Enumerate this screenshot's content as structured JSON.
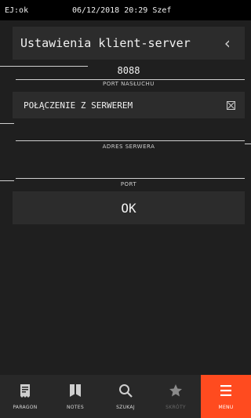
{
  "statusbar": {
    "left": "EJ:ok",
    "center": "06/12/2018 20:29 Szef"
  },
  "header": {
    "title": "Ustawienia klient-server",
    "back_icon": "chevron-left-icon"
  },
  "fields": {
    "port_nasluchu": {
      "value": "8088",
      "label": "PORT NASŁUCHU"
    },
    "polaczenie": {
      "label": "POŁĄCZENIE Z SERWEREM",
      "checked": true
    },
    "adres_serwera": {
      "value": "",
      "label": "ADRES SERWERA"
    },
    "port": {
      "value": "",
      "label": "PORT"
    }
  },
  "ok_button": {
    "label": "OK"
  },
  "bottom_nav": {
    "items": [
      {
        "label": "PARAGON",
        "icon": "receipt-icon",
        "state": "normal"
      },
      {
        "label": "NOTES",
        "icon": "notebook-icon",
        "state": "normal"
      },
      {
        "label": "SZUKAJ",
        "icon": "search-icon",
        "state": "normal"
      },
      {
        "label": "SKRÓTY",
        "icon": "star-icon",
        "state": "disabled"
      },
      {
        "label": "MENU",
        "icon": "menu-icon",
        "state": "active"
      }
    ]
  },
  "colors": {
    "background": "#1f1f1f",
    "panel": "#2c2c2c",
    "accent": "#ff4b1f",
    "statusbar": "#000000"
  }
}
